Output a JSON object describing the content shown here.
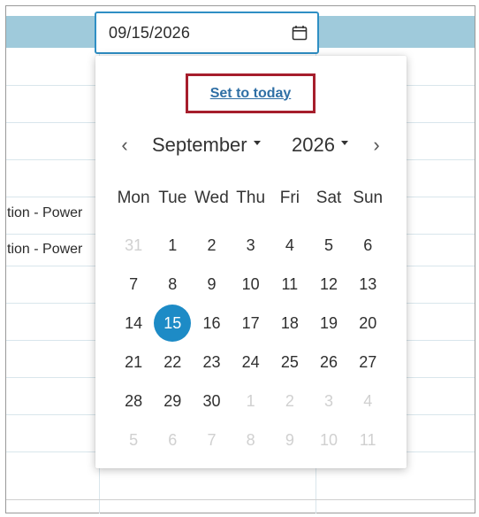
{
  "date_input": {
    "value": "09/15/2026"
  },
  "background": {
    "rows": [
      "tion - Power",
      "tion - Power"
    ]
  },
  "datepicker": {
    "today_label": "Set to today",
    "month": "September",
    "year": "2026",
    "prev_symbol": "‹",
    "next_symbol": "›",
    "weekdays": [
      "Mon",
      "Tue",
      "Wed",
      "Thu",
      "Fri",
      "Sat",
      "Sun"
    ],
    "weeks": [
      [
        {
          "d": "31",
          "other": true
        },
        {
          "d": "1"
        },
        {
          "d": "2"
        },
        {
          "d": "3"
        },
        {
          "d": "4"
        },
        {
          "d": "5"
        },
        {
          "d": "6"
        }
      ],
      [
        {
          "d": "7"
        },
        {
          "d": "8"
        },
        {
          "d": "9"
        },
        {
          "d": "10"
        },
        {
          "d": "11"
        },
        {
          "d": "12"
        },
        {
          "d": "13"
        }
      ],
      [
        {
          "d": "14"
        },
        {
          "d": "15",
          "selected": true
        },
        {
          "d": "16"
        },
        {
          "d": "17"
        },
        {
          "d": "18"
        },
        {
          "d": "19"
        },
        {
          "d": "20"
        }
      ],
      [
        {
          "d": "21"
        },
        {
          "d": "22"
        },
        {
          "d": "23"
        },
        {
          "d": "24"
        },
        {
          "d": "25"
        },
        {
          "d": "26"
        },
        {
          "d": "27"
        }
      ],
      [
        {
          "d": "28"
        },
        {
          "d": "29"
        },
        {
          "d": "30"
        },
        {
          "d": "1",
          "other": true
        },
        {
          "d": "2",
          "other": true
        },
        {
          "d": "3",
          "other": true
        },
        {
          "d": "4",
          "other": true
        }
      ],
      [
        {
          "d": "5",
          "other": true
        },
        {
          "d": "6",
          "other": true
        },
        {
          "d": "7",
          "other": true
        },
        {
          "d": "8",
          "other": true
        },
        {
          "d": "9",
          "other": true
        },
        {
          "d": "10",
          "other": true
        },
        {
          "d": "11",
          "other": true
        }
      ]
    ]
  },
  "colors": {
    "accent": "#1d8bc6",
    "header_band": "#9fcadb",
    "highlight_box": "#a61e2c",
    "link": "#2f6fa5"
  }
}
